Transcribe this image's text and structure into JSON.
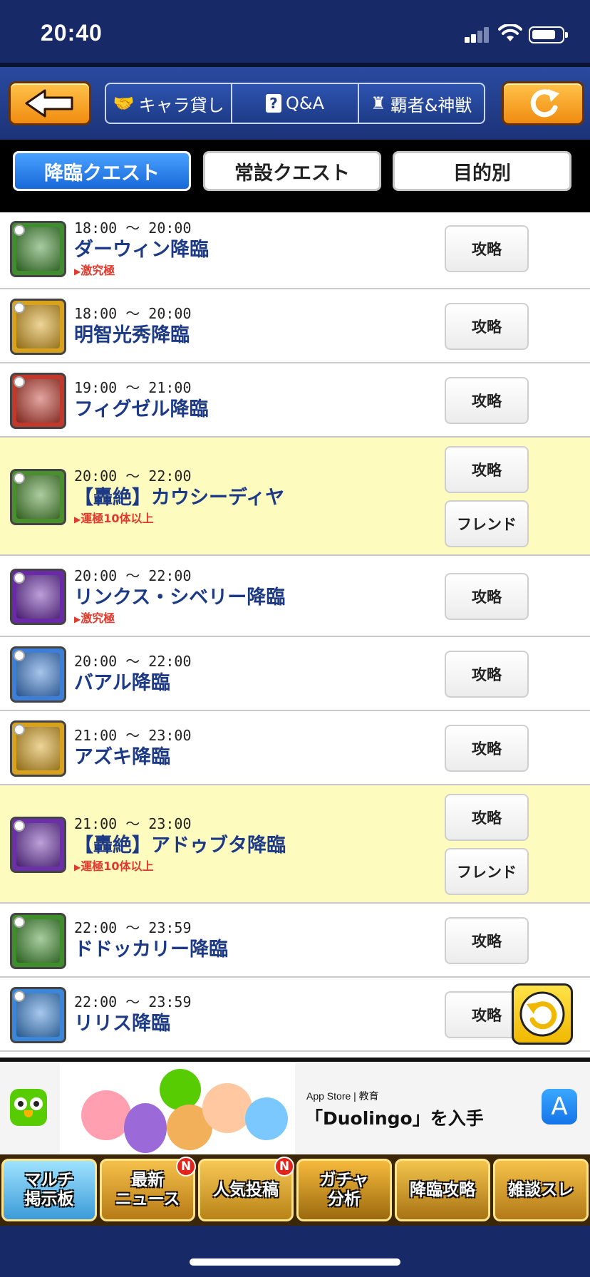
{
  "status_bar": {
    "time": "20:40"
  },
  "top_nav": {
    "seg_lend": "キャラ貸し",
    "seg_qa": "Q&A",
    "seg_qa_mark": "?",
    "seg_boss": "覇者&神獣"
  },
  "tabs": {
    "descent": "降臨クエスト",
    "permanent": "常設クエスト",
    "purpose": "目的別"
  },
  "quests": [
    {
      "time": "18:00 〜 20:00",
      "name": "ダーウィン降臨",
      "tag": "激究極",
      "buttons": [
        "攻略"
      ],
      "highlight": false,
      "color": "#3f8d2f"
    },
    {
      "time": "18:00 〜 20:00",
      "name": "明智光秀降臨",
      "tag": "",
      "buttons": [
        "攻略"
      ],
      "highlight": false,
      "color": "#d9a21c"
    },
    {
      "time": "19:00 〜 21:00",
      "name": "フィグゼル降臨",
      "tag": "",
      "buttons": [
        "攻略"
      ],
      "highlight": false,
      "color": "#c0392b"
    },
    {
      "time": "20:00 〜 22:00",
      "name": "【轟絶】カウシーディヤ",
      "tag": "運極10体以上",
      "buttons": [
        "攻略",
        "フレンド"
      ],
      "highlight": true,
      "color": "#4a8f2e"
    },
    {
      "time": "20:00 〜 22:00",
      "name": "リンクス・シベリー降臨",
      "tag": "激究極",
      "buttons": [
        "攻略"
      ],
      "highlight": false,
      "color": "#6a2aa8"
    },
    {
      "time": "20:00 〜 22:00",
      "name": "バアル降臨",
      "tag": "",
      "buttons": [
        "攻略"
      ],
      "highlight": false,
      "color": "#3d7fd6"
    },
    {
      "time": "21:00 〜 23:00",
      "name": "アズキ降臨",
      "tag": "",
      "buttons": [
        "攻略"
      ],
      "highlight": false,
      "color": "#d8a21e"
    },
    {
      "time": "21:00 〜 23:00",
      "name": "【轟絶】アドゥブタ降臨",
      "tag": "運極10体以上",
      "buttons": [
        "攻略",
        "フレンド"
      ],
      "highlight": true,
      "color": "#6b2fa8"
    },
    {
      "time": "22:00 〜 23:59",
      "name": "ドドッカリー降臨",
      "tag": "",
      "buttons": [
        "攻略"
      ],
      "highlight": false,
      "color": "#3e8f2c"
    },
    {
      "time": "22:00 〜 23:59",
      "name": "リリス降臨",
      "tag": "",
      "buttons": [
        "攻略"
      ],
      "highlight": false,
      "color": "#3b86d8"
    }
  ],
  "ad": {
    "store_line": "App Store | 教育",
    "cta": "「Duolingo」を入手"
  },
  "bottom_menu": {
    "multi_line1": "マルチ",
    "multi_line2": "掲示板",
    "news_line1": "最新",
    "news_line2": "ニュース",
    "news_badge": "N",
    "popular": "人気投稿",
    "popular_badge": "N",
    "gacha_line1": "ガチャ",
    "gacha_line2": "分析",
    "descent": "降臨攻略",
    "chat": "雑談スレ"
  },
  "icons": {
    "back": "back-arrow-icon",
    "reload": "reload-icon",
    "lend": "handshake-icon",
    "qa": "question-icon",
    "boss": "rook-icon",
    "float_refresh": "refresh-icon"
  }
}
